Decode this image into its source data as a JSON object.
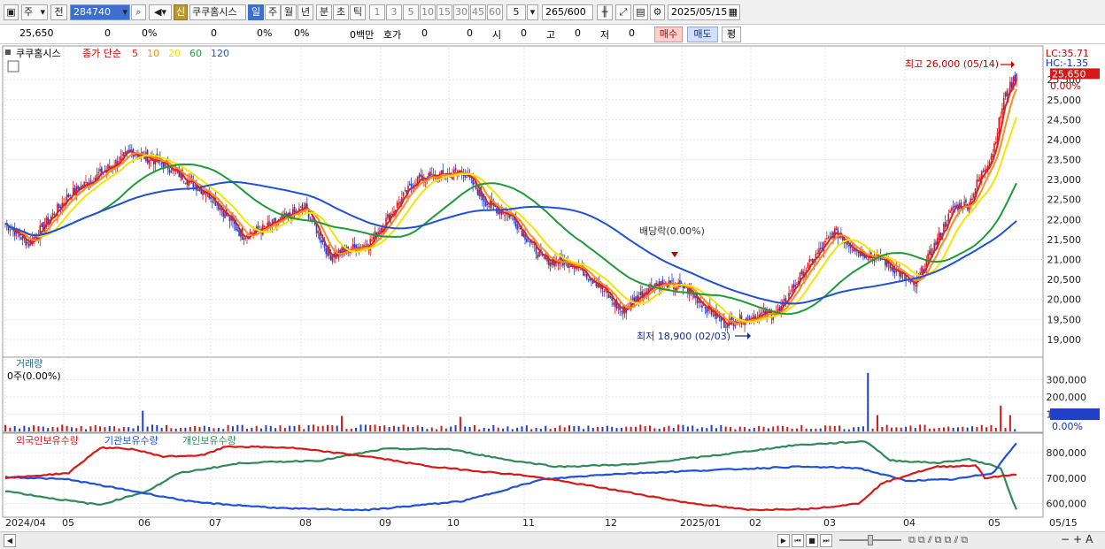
{
  "toolbar": {
    "market": "주",
    "view": "전",
    "code": "284740",
    "sign": "신",
    "name": "쿠쿠홈시스",
    "periods": [
      "일",
      "주",
      "월",
      "년",
      "분",
      "초",
      "틱"
    ],
    "active_period": "일",
    "minutes": [
      "1",
      "3",
      "5",
      "10",
      "15",
      "30",
      "45",
      "60"
    ],
    "interval": "5",
    "count": "265",
    "count_total": "/600",
    "date": "2025/05/15"
  },
  "info": {
    "price": "25,650",
    "change": "0",
    "rate": "0%",
    "volume": "0",
    "vol_rate": "0%",
    "rate2": "0%",
    "amount": "0백만",
    "hoga_label": "호가",
    "hoga1": "0",
    "hoga2": "0",
    "open_label": "시",
    "open": "0",
    "high_label": "고",
    "high": "0",
    "low_label": "저",
    "low": "0",
    "buy_label": "매수",
    "sell_label": "매도",
    "avg_label": "평"
  },
  "legend": {
    "name": "쿠쿠홈시스",
    "price_label": "종가 단순",
    "ma": [
      {
        "period": "5",
        "color": "#e02020"
      },
      {
        "period": "10",
        "color": "#ff8c1a"
      },
      {
        "period": "20",
        "color": "#f2e600"
      },
      {
        "period": "60",
        "color": "#1f9a3a"
      },
      {
        "period": "120",
        "color": "#2050d8"
      }
    ]
  },
  "chart_data": {
    "type": "candlestick",
    "symbol": "쿠쿠홈시스",
    "x_range": [
      "2024/04",
      "2025/05/15"
    ],
    "x_ticks": [
      "2024/04",
      "05",
      "06",
      "07",
      "08",
      "09",
      "10",
      "11",
      "12",
      "2025/01",
      "02",
      "03",
      "04",
      "05",
      "05/15"
    ],
    "price_axis": {
      "ylim": [
        18600,
        26300
      ],
      "ticks": [
        19000,
        19500,
        20000,
        20500,
        21000,
        21500,
        22000,
        22500,
        23000,
        23500,
        24000,
        24500,
        25000,
        25500
      ],
      "tick_labels": [
        "19,000",
        "19,500",
        "20,000",
        "20,500",
        "21,000",
        "21,500",
        "22,000",
        "22,500",
        "23,000",
        "23,500",
        "24,000",
        "24,500",
        "25,000",
        "25,500"
      ]
    },
    "price_keypoints": [
      {
        "t": 0,
        "p": 21900
      },
      {
        "t": 15,
        "p": 21400
      },
      {
        "t": 40,
        "p": 22600
      },
      {
        "t": 80,
        "p": 23700
      },
      {
        "t": 100,
        "p": 23400
      },
      {
        "t": 130,
        "p": 22600
      },
      {
        "t": 150,
        "p": 21600
      },
      {
        "t": 165,
        "p": 21800
      },
      {
        "t": 190,
        "p": 22300
      },
      {
        "t": 205,
        "p": 21100
      },
      {
        "t": 230,
        "p": 21400
      },
      {
        "t": 260,
        "p": 23000
      },
      {
        "t": 290,
        "p": 23200
      },
      {
        "t": 305,
        "p": 22400
      },
      {
        "t": 320,
        "p": 22100
      },
      {
        "t": 340,
        "p": 21000
      },
      {
        "t": 360,
        "p": 20900
      },
      {
        "t": 375,
        "p": 20400
      },
      {
        "t": 390,
        "p": 19700
      },
      {
        "t": 410,
        "p": 20400
      },
      {
        "t": 430,
        "p": 20300
      },
      {
        "t": 455,
        "p": 19400
      },
      {
        "t": 465,
        "p": 19500
      },
      {
        "t": 490,
        "p": 19700
      },
      {
        "t": 500,
        "p": 20400
      },
      {
        "t": 515,
        "p": 21200
      },
      {
        "t": 525,
        "p": 21700
      },
      {
        "t": 540,
        "p": 21200
      },
      {
        "t": 555,
        "p": 21000
      },
      {
        "t": 565,
        "p": 20700
      },
      {
        "t": 575,
        "p": 20300
      },
      {
        "t": 590,
        "p": 21500
      },
      {
        "t": 600,
        "p": 22300
      },
      {
        "t": 610,
        "p": 22400
      },
      {
        "t": 615,
        "p": 22900
      },
      {
        "t": 625,
        "p": 23700
      },
      {
        "t": 632,
        "p": 25000
      },
      {
        "t": 640,
        "p": 25650
      }
    ],
    "ma_series": [
      {
        "name": "5",
        "color": "#e02020",
        "window": 5
      },
      {
        "name": "10",
        "color": "#ff8c1a",
        "window": 10
      },
      {
        "name": "20",
        "color": "#f2e600",
        "window": 20
      },
      {
        "name": "60",
        "color": "#1f9a3a",
        "window": 60
      },
      {
        "name": "120",
        "color": "#2050d8",
        "window": 120
      }
    ],
    "annotations": {
      "high": "최고 26,000 (05/14)",
      "low": "최저 18,900 (02/03)",
      "dividend": "배당락(0.00%)"
    },
    "price_labels": {
      "lc": "LC:35.71",
      "hc": "HC:-1.35",
      "current": "25,650",
      "current_value": 25650,
      "current_rate": "0.00%"
    },
    "volume": {
      "label": "거래량",
      "sub": "0주(0.00%)",
      "ylim": [
        0,
        380000
      ],
      "ticks": [
        100000,
        200000,
        300000
      ],
      "tick_labels": [
        "100,000",
        "200,000",
        "300,000"
      ],
      "current_rate": "0.00%",
      "spikes": [
        {
          "t": 88,
          "v": 120000
        },
        {
          "t": 215,
          "v": 90000
        },
        {
          "t": 290,
          "v": 85000
        },
        {
          "t": 548,
          "v": 340000
        },
        {
          "t": 552,
          "v": 95000
        },
        {
          "t": 630,
          "v": 150000
        },
        {
          "t": 636,
          "v": 95000
        }
      ]
    },
    "holdings": {
      "labels": [
        "외국인보유수량",
        "기관보유수량",
        "개인보유수량"
      ],
      "colors": [
        "#d81818",
        "#2050d8",
        "#2f8a58"
      ],
      "ylim": [
        550000,
        870000
      ],
      "ticks": [
        600000,
        700000,
        800000
      ],
      "tick_labels": [
        "600,000",
        "700,000",
        "800,000"
      ],
      "foreign": [
        {
          "t": 0,
          "v": 700000
        },
        {
          "t": 40,
          "v": 720000
        },
        {
          "t": 60,
          "v": 820000
        },
        {
          "t": 80,
          "v": 815000
        },
        {
          "t": 100,
          "v": 785000
        },
        {
          "t": 125,
          "v": 790000
        },
        {
          "t": 140,
          "v": 825000
        },
        {
          "t": 180,
          "v": 820000
        },
        {
          "t": 230,
          "v": 785000
        },
        {
          "t": 270,
          "v": 745000
        },
        {
          "t": 330,
          "v": 710000
        },
        {
          "t": 380,
          "v": 660000
        },
        {
          "t": 430,
          "v": 605000
        },
        {
          "t": 470,
          "v": 575000
        },
        {
          "t": 510,
          "v": 580000
        },
        {
          "t": 540,
          "v": 600000
        },
        {
          "t": 555,
          "v": 680000
        },
        {
          "t": 575,
          "v": 720000
        },
        {
          "t": 590,
          "v": 745000
        },
        {
          "t": 615,
          "v": 750000
        },
        {
          "t": 620,
          "v": 700000
        },
        {
          "t": 640,
          "v": 715000
        }
      ],
      "institution": [
        {
          "t": 0,
          "v": 705000
        },
        {
          "t": 40,
          "v": 695000
        },
        {
          "t": 80,
          "v": 650000
        },
        {
          "t": 120,
          "v": 605000
        },
        {
          "t": 180,
          "v": 580000
        },
        {
          "t": 230,
          "v": 575000
        },
        {
          "t": 290,
          "v": 610000
        },
        {
          "t": 340,
          "v": 695000
        },
        {
          "t": 380,
          "v": 715000
        },
        {
          "t": 440,
          "v": 730000
        },
        {
          "t": 500,
          "v": 745000
        },
        {
          "t": 540,
          "v": 740000
        },
        {
          "t": 570,
          "v": 690000
        },
        {
          "t": 600,
          "v": 695000
        },
        {
          "t": 625,
          "v": 720000
        },
        {
          "t": 640,
          "v": 840000
        }
      ],
      "individual": [
        {
          "t": 0,
          "v": 650000
        },
        {
          "t": 30,
          "v": 620000
        },
        {
          "t": 60,
          "v": 595000
        },
        {
          "t": 90,
          "v": 650000
        },
        {
          "t": 110,
          "v": 720000
        },
        {
          "t": 150,
          "v": 760000
        },
        {
          "t": 200,
          "v": 770000
        },
        {
          "t": 240,
          "v": 815000
        },
        {
          "t": 280,
          "v": 815000
        },
        {
          "t": 320,
          "v": 770000
        },
        {
          "t": 350,
          "v": 745000
        },
        {
          "t": 400,
          "v": 755000
        },
        {
          "t": 450,
          "v": 790000
        },
        {
          "t": 500,
          "v": 830000
        },
        {
          "t": 545,
          "v": 845000
        },
        {
          "t": 560,
          "v": 770000
        },
        {
          "t": 590,
          "v": 760000
        },
        {
          "t": 610,
          "v": 775000
        },
        {
          "t": 630,
          "v": 740000
        },
        {
          "t": 636,
          "v": 640000
        },
        {
          "t": 640,
          "v": 575000
        }
      ]
    }
  }
}
